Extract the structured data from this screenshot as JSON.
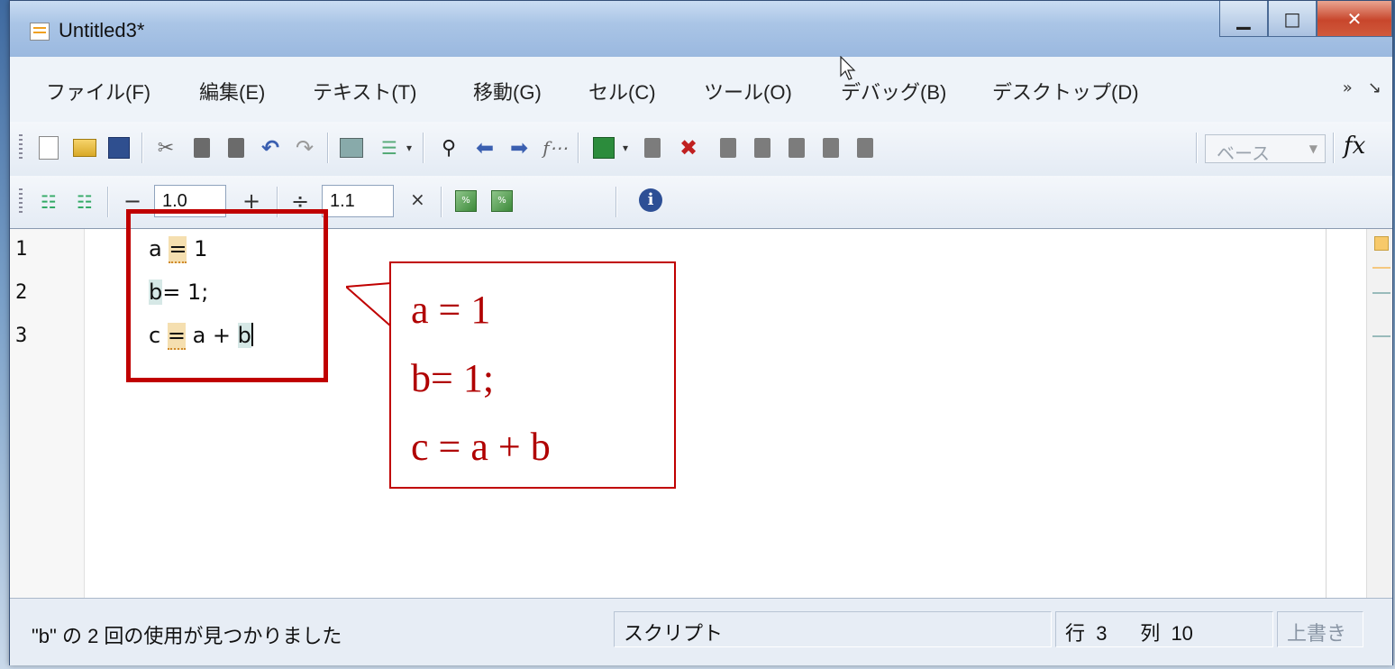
{
  "window": {
    "title": "Untitled3*"
  },
  "menu": [
    {
      "label": "ファイル(F)"
    },
    {
      "label": "編集(E)"
    },
    {
      "label": "テキスト(T)"
    },
    {
      "label": "移動(G)"
    },
    {
      "label": "セル(C)"
    },
    {
      "label": "ツール(O)"
    },
    {
      "label": "デバッグ(B)"
    },
    {
      "label": "デスクトップ(D)"
    }
  ],
  "toolbar": {
    "workspace_select": "ベース",
    "fx_label": "fx"
  },
  "cell_toolbar": {
    "minus_label": "−",
    "plus_label": "+",
    "divide_label": "÷",
    "times_label": "×",
    "decrement_value": "1.0",
    "scale_value": "1.1"
  },
  "editor": {
    "line_numbers": [
      "1",
      "2",
      "3"
    ],
    "lines": {
      "l1_a": "a ",
      "l1_eq": "=",
      "l1_rest": " 1",
      "l2_b": "b",
      "l2_rest": "= 1;",
      "l3_c": "c ",
      "l3_eq": "=",
      "l3_mid": " a + ",
      "l3_b": "b"
    }
  },
  "callout": {
    "lines": [
      "a = 1",
      "b= 1;",
      "c = a + b"
    ]
  },
  "status": {
    "message": "\"b\" の 2 回の使用が見つかりました",
    "mode": "スクリプト",
    "row_label": "行",
    "row_value": "3",
    "col_label": "列",
    "col_value": "10",
    "overwrite": "上書き"
  },
  "colors": {
    "annotation_red": "#c00000",
    "match_highlight": "#f5dfb0",
    "variable_highlight": "#d6e8e6"
  }
}
